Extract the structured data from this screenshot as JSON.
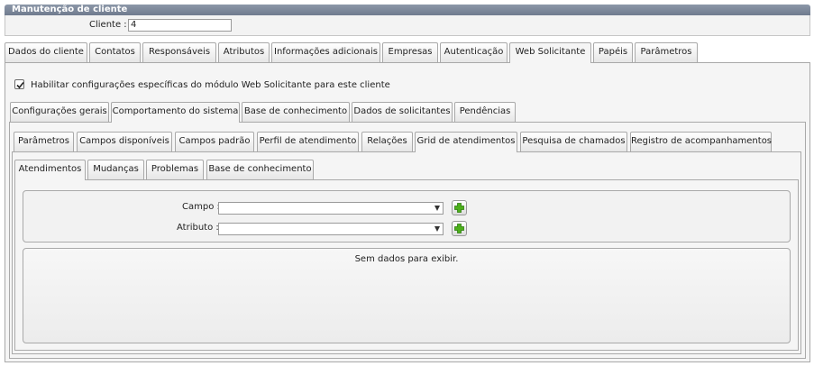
{
  "window": {
    "title": "Manutenção de cliente"
  },
  "client": {
    "label": "Cliente :",
    "value": "4"
  },
  "main_tabs": [
    {
      "label": "Dados do cliente"
    },
    {
      "label": "Contatos"
    },
    {
      "label": "Responsáveis"
    },
    {
      "label": "Atributos"
    },
    {
      "label": "Informações adicionais"
    },
    {
      "label": "Empresas"
    },
    {
      "label": "Autenticação"
    },
    {
      "label": "Web Solicitante",
      "active": true
    },
    {
      "label": "Papéis"
    },
    {
      "label": "Parâmetros"
    }
  ],
  "enable_checkbox": {
    "checked": true,
    "label": "Habilitar configurações específicas do módulo Web Solicitante para este cliente"
  },
  "level2_tabs": [
    {
      "label": "Configurações gerais"
    },
    {
      "label": "Comportamento do sistema",
      "active": true
    },
    {
      "label": "Base de conhecimento"
    },
    {
      "label": "Dados de solicitantes"
    },
    {
      "label": "Pendências"
    }
  ],
  "level3_tabs": [
    {
      "label": "Parâmetros"
    },
    {
      "label": "Campos disponíveis"
    },
    {
      "label": "Campos padrão"
    },
    {
      "label": "Perfil de atendimento"
    },
    {
      "label": "Relações"
    },
    {
      "label": "Grid de atendimentos",
      "active": true
    },
    {
      "label": "Pesquisa de chamados"
    },
    {
      "label": "Registro de acompanhamentos"
    }
  ],
  "level4_tabs": [
    {
      "label": "Atendimentos",
      "active": true
    },
    {
      "label": "Mudanças"
    },
    {
      "label": "Problemas"
    },
    {
      "label": "Base de conhecimento"
    }
  ],
  "form": {
    "campo_label": "Campo :",
    "campo_value": "",
    "atributo_label": "Atributo :",
    "atributo_value": ""
  },
  "grid": {
    "empty_message": "Sem dados para exibir."
  },
  "colors": {
    "title_bar": "#7a8699",
    "add_icon": "#4caf1a"
  }
}
